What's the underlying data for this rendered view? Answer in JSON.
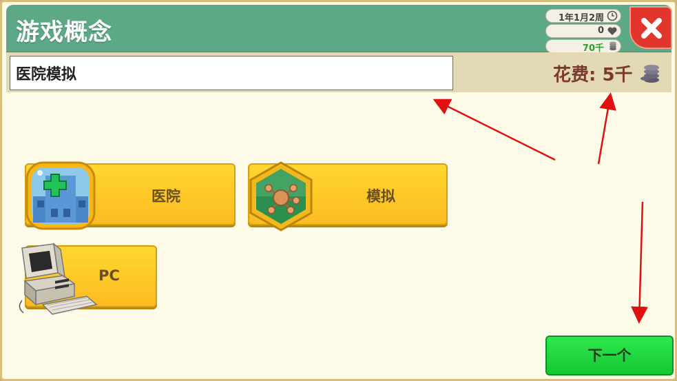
{
  "header": {
    "title": "游戏概念",
    "date": "1年1月2周",
    "hearts": "0",
    "money": "70千"
  },
  "name_row": {
    "game_name": "医院模拟",
    "cost": "花费: 5千"
  },
  "chips": {
    "topic": "医院",
    "genre": "模拟",
    "platform": "PC"
  },
  "footer": {
    "next_label": "下一个"
  },
  "colors": {
    "header": "#5da886",
    "chip": "#fdc926",
    "next": "#1fd63c",
    "close": "#e2352b",
    "arrows": "#e01010"
  },
  "icons": {
    "date": "clock-icon",
    "hearts": "heart-icon",
    "money": "coins-icon",
    "close": "close-icon",
    "topic": "hospital-icon",
    "genre": "molecule-icon",
    "platform": "computer-icon"
  }
}
